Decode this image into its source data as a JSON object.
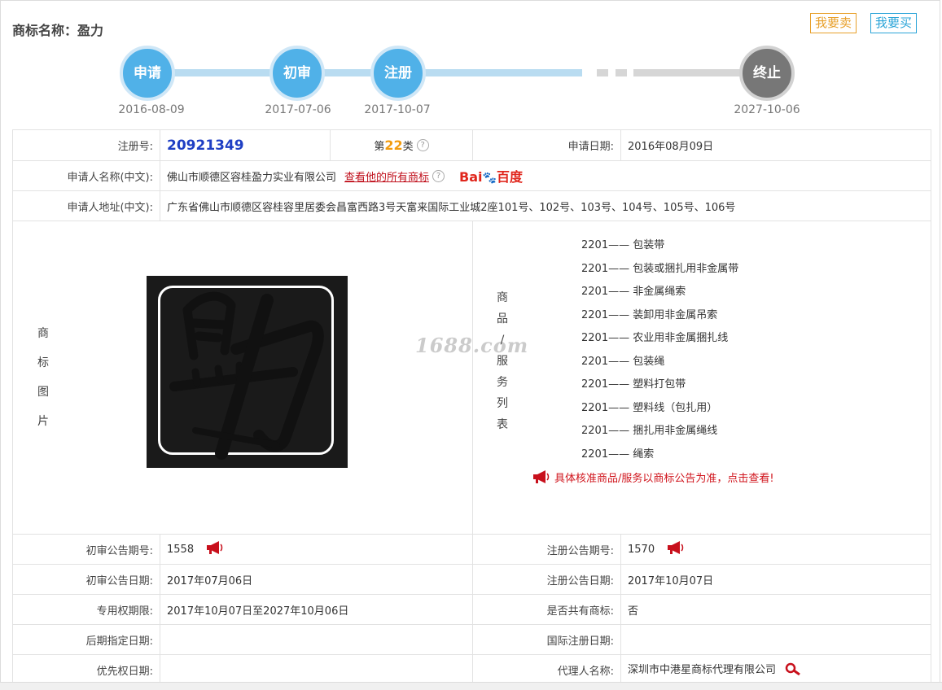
{
  "header": {
    "title": "商标名称：盈力",
    "sell_label": "我要卖",
    "buy_label": "我要买"
  },
  "timeline": {
    "steps": [
      {
        "label": "申请",
        "date": "2016-08-09"
      },
      {
        "label": "初审",
        "date": "2017-07-06"
      },
      {
        "label": "注册",
        "date": "2017-10-07"
      },
      {
        "label": "终止",
        "date": "2027-10-06"
      }
    ]
  },
  "colors": {
    "accent_blue": "#50b1e8",
    "terminated_grey": "#777777",
    "link_red": "#c0101c",
    "reg_no_blue": "#1f3fc4",
    "class_orange": "#f29b0e"
  },
  "details": {
    "reg_no_label": "注册号:",
    "reg_no": "20921349",
    "class_prefix": "第",
    "class_num": "22",
    "class_suffix": "类",
    "apply_date_label": "申请日期:",
    "apply_date": "2016年08月09日",
    "applicant_name_label": "申请人名称(中文):",
    "applicant_name": "佛山市顺德区容桂盈力实业有限公司",
    "all_marks_link": "查看他的所有商标",
    "baidu_text": "Bai",
    "baidu_paw": "🐾",
    "baidu_cn": "百度",
    "applicant_addr_label": "申请人地址(中文):",
    "applicant_addr": "广东省佛山市顺德区容桂容里居委会昌富西路3号天富来国际工业城2座101号、102号、103号、104号、105号、106号",
    "image_label_chars": [
      "商",
      "标",
      "图",
      "片"
    ],
    "goods_label_chars": [
      "商",
      "品",
      "/",
      "服",
      "务",
      "列",
      "表"
    ],
    "goods": [
      "2201—— 包装带",
      "2201—— 包装或捆扎用非金属带",
      "2201—— 非金属绳索",
      "2201—— 装卸用非金属吊索",
      "2201—— 农业用非金属捆扎线",
      "2201—— 包装绳",
      "2201—— 塑料打包带",
      "2201—— 塑料线（包扎用）",
      "2201—— 捆扎用非金属绳线",
      "2201—— 绳索"
    ],
    "goods_notice": "具体核准商品/服务以商标公告为准，点击查看!",
    "watermark": "1688.com",
    "prelim_no_label": "初审公告期号:",
    "prelim_no": "1558",
    "reg_ann_no_label": "注册公告期号:",
    "reg_ann_no": "1570",
    "prelim_date_label": "初审公告日期:",
    "prelim_date": "2017年07月06日",
    "reg_ann_date_label": "注册公告日期:",
    "reg_ann_date": "2017年10月07日",
    "exclusive_label": "专用权期限:",
    "exclusive_period": "2017年10月07日至2027年10月06日",
    "shared_label": "是否共有商标:",
    "shared": "否",
    "later_date_label": "后期指定日期:",
    "later_date": "",
    "intl_reg_label": "国际注册日期:",
    "intl_reg": "",
    "priority_label": "优先权日期:",
    "priority": "",
    "agent_label": "代理人名称:",
    "agent": "深圳市中港星商标代理有限公司"
  }
}
